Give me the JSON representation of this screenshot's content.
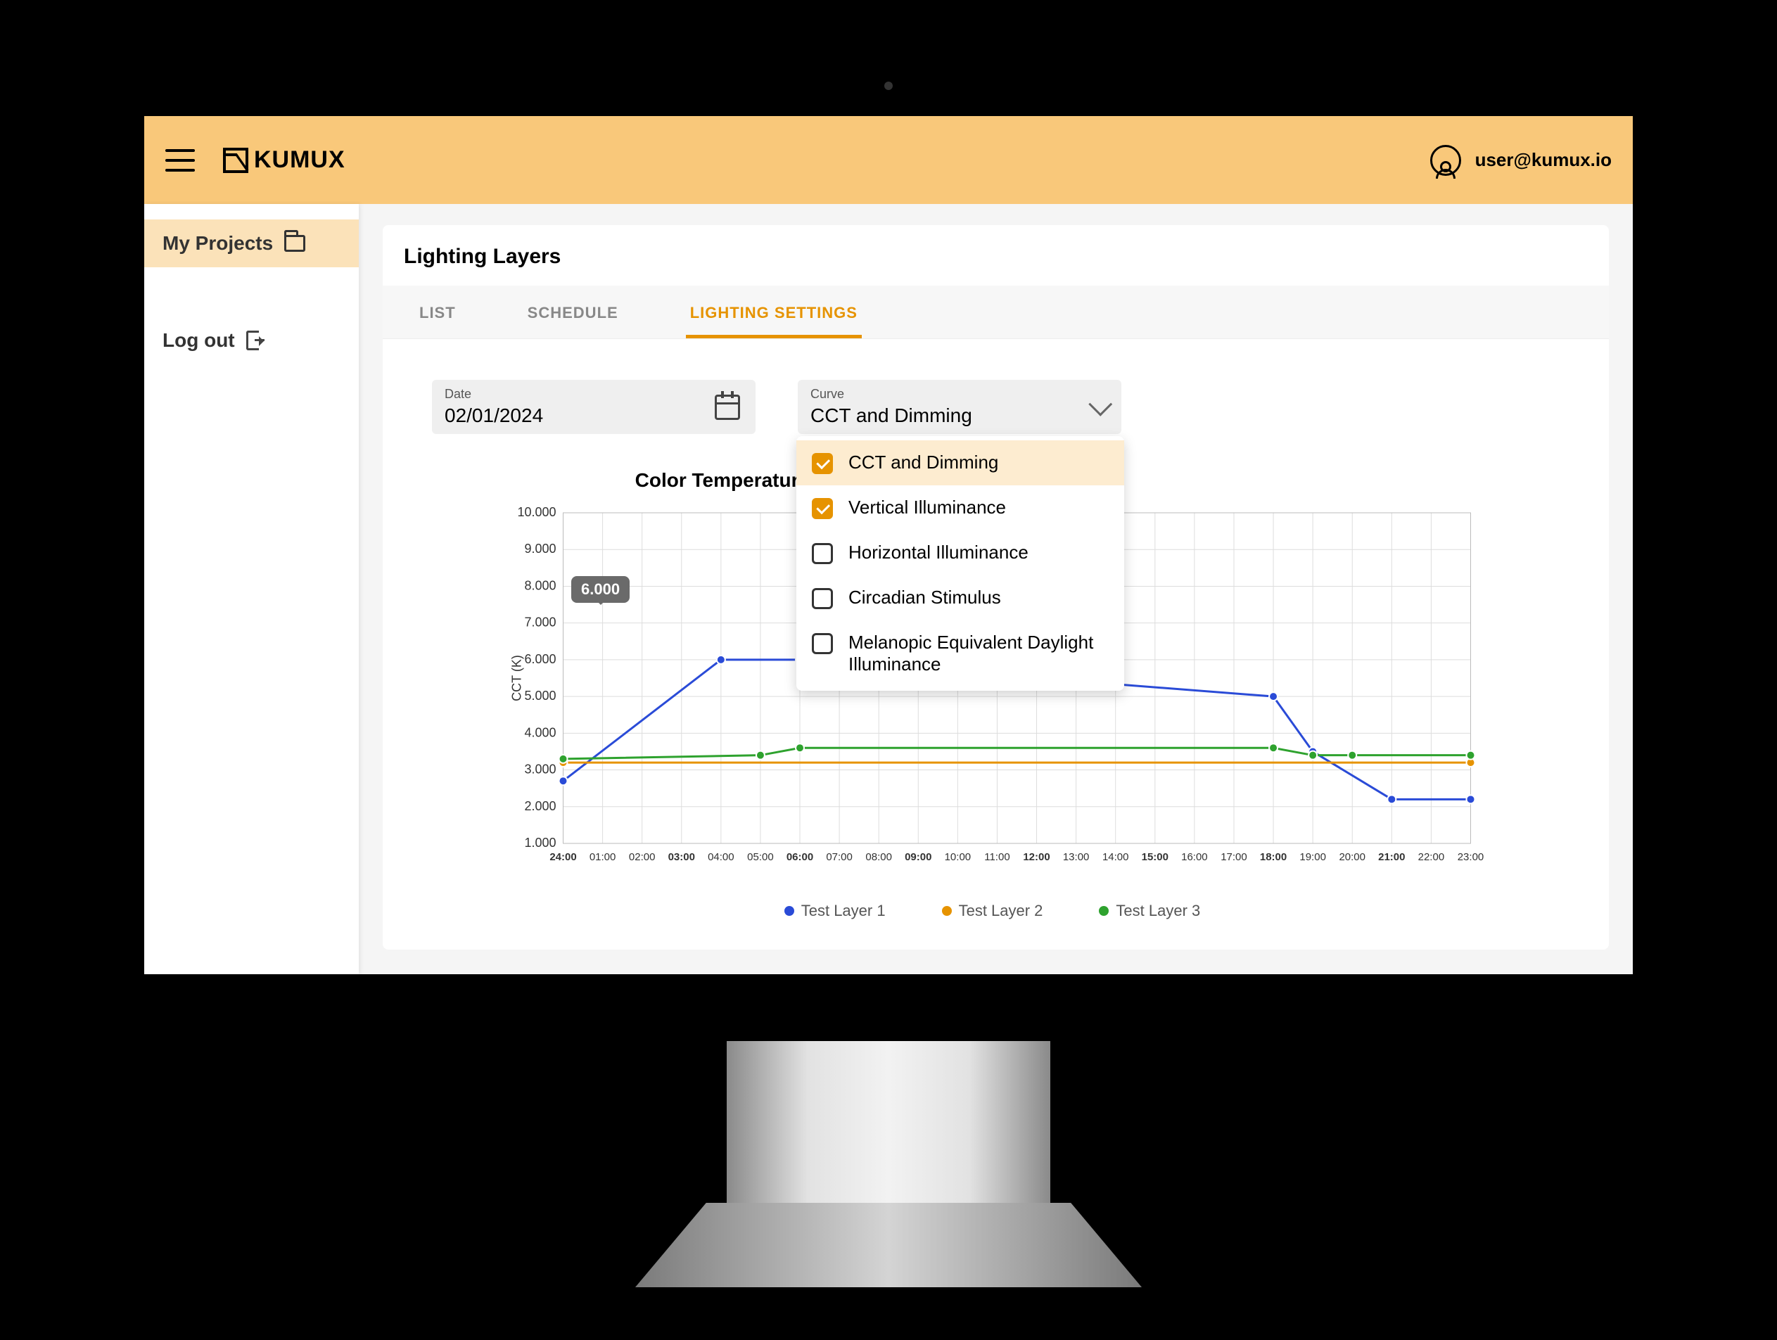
{
  "brand": "KUMUX",
  "user_email": "user@kumux.io",
  "sidebar": {
    "items": [
      {
        "label": "My Projects",
        "active": true
      },
      {
        "label": "Log out",
        "active": false
      }
    ]
  },
  "page_title": "Lighting Layers",
  "tabs": [
    {
      "label": "LIST",
      "active": false
    },
    {
      "label": "SCHEDULE",
      "active": false
    },
    {
      "label": "LIGHTING SETTINGS",
      "active": true
    }
  ],
  "date_input": {
    "label": "Date",
    "value": "02/01/2024"
  },
  "curve_select": {
    "label": "Curve",
    "value": "CCT and Dimming",
    "options": [
      {
        "label": "CCT and Dimming",
        "checked": true
      },
      {
        "label": "Vertical Illuminance",
        "checked": true
      },
      {
        "label": "Horizontal Illuminance",
        "checked": false
      },
      {
        "label": "Circadian Stimulus",
        "checked": false
      },
      {
        "label": "Melanopic Equivalent Daylight Illuminance",
        "checked": false
      }
    ]
  },
  "chart_titles": {
    "left": "Color Temperature",
    "right": ""
  },
  "tooltip_value": "6.000",
  "legend": [
    "Test Layer 1",
    "Test Layer 2",
    "Test Layer 3"
  ],
  "chart_data": {
    "type": "line",
    "title": "Color Temperature",
    "xlabel": "",
    "ylabel": "CCT (K)",
    "ylim": [
      1000,
      10000
    ],
    "x_ticks": [
      "24:00",
      "01:00",
      "02:00",
      "03:00",
      "04:00",
      "05:00",
      "06:00",
      "07:00",
      "08:00",
      "09:00",
      "10:00",
      "11:00",
      "12:00",
      "13:00",
      "14:00",
      "15:00",
      "16:00",
      "17:00",
      "18:00",
      "19:00",
      "20:00",
      "21:00",
      "22:00",
      "23:00"
    ],
    "y_ticks": [
      "1.000",
      "2.000",
      "3.000",
      "4.000",
      "5.000",
      "6.000",
      "7.000",
      "8.000",
      "9.000",
      "10.000"
    ],
    "series": [
      {
        "name": "Test Layer 1",
        "color": "#2a4bd7",
        "x": [
          0,
          4,
          6,
          18,
          19,
          21,
          23
        ],
        "values": [
          2700,
          6000,
          6000,
          5000,
          3500,
          2200,
          2200
        ]
      },
      {
        "name": "Test Layer 2",
        "color": "#e69300",
        "x": [
          0,
          23
        ],
        "values": [
          3200,
          3200
        ]
      },
      {
        "name": "Test Layer 3",
        "color": "#2ea22e",
        "x": [
          0,
          5,
          6,
          18,
          19,
          20,
          23
        ],
        "values": [
          3300,
          3400,
          3600,
          3600,
          3400,
          3400,
          3400
        ]
      }
    ]
  }
}
